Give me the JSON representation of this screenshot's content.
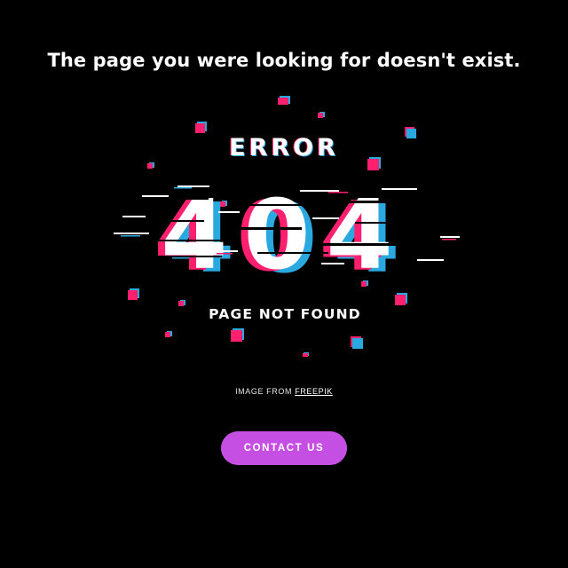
{
  "heading": "The page you were looking for doesn't exist.",
  "illustration": {
    "error_label": "ERROR",
    "code": "404",
    "subtitle": "PAGE NOT FOUND",
    "colors": {
      "text": "#ffffff",
      "glitch_pink": "#ff1f6f",
      "glitch_blue": "#2aa9e0",
      "background": "#000000"
    }
  },
  "caption": {
    "prefix": "IMAGE FROM",
    "link_text": "FREEPIK"
  },
  "contact_button": {
    "label": "CONTACT US",
    "color": "#c64fe3"
  }
}
